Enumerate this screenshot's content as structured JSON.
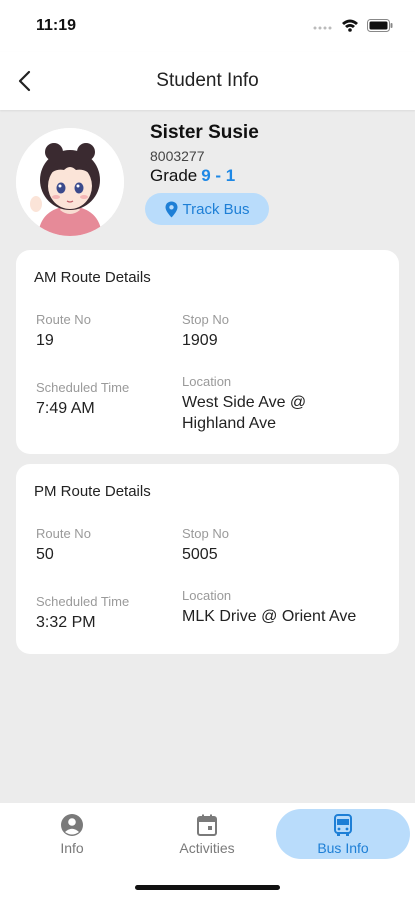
{
  "status": {
    "time": "11:19"
  },
  "header": {
    "title": "Student Info"
  },
  "student": {
    "name": "Sister Susie",
    "id": "8003277",
    "grade_label": "Grade",
    "grade_value": "9 - 1",
    "track_label": "Track Bus"
  },
  "am_route": {
    "title": "AM Route Details",
    "route_no_label": "Route No",
    "route_no": "19",
    "stop_no_label": "Stop No",
    "stop_no": "1909",
    "time_label": "Scheduled Time",
    "time": "7:49 AM",
    "location_label": "Location",
    "location_line1": "West Side Ave @",
    "location_line2": "Highland Ave"
  },
  "pm_route": {
    "title": "PM Route Details",
    "route_no_label": "Route No",
    "route_no": "50",
    "stop_no_label": "Stop No",
    "stop_no": "5005",
    "time_label": "Scheduled Time",
    "time": "3:32 PM",
    "location_label": "Location",
    "location": "MLK Drive @ Orient Ave"
  },
  "tabs": [
    {
      "label": "Info",
      "icon": "person-icon",
      "active": false
    },
    {
      "label": "Activities",
      "icon": "calendar-icon",
      "active": false
    },
    {
      "label": "Bus Info",
      "icon": "bus-icon",
      "active": true
    }
  ],
  "colors": {
    "accent": "#1e88e5",
    "accent_soft": "#b9dcfb",
    "background": "#ececec"
  }
}
